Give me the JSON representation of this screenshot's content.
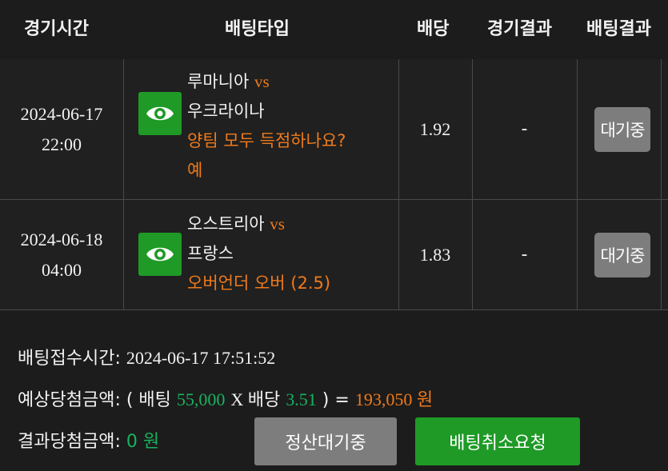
{
  "header": {
    "time": "경기시간",
    "bet_type": "배팅타입",
    "odds": "배당",
    "game_result": "경기결과",
    "bet_result": "배팅결과"
  },
  "bets": [
    {
      "date": "2024-06-17",
      "time": "22:00",
      "home": "루마니아",
      "vs": "vs",
      "away": "우크라이나",
      "market": "양팀 모두 득점하나요?",
      "pick": "예",
      "odds": "1.92",
      "result": "-",
      "status": "대기중",
      "icon": "eye-icon"
    },
    {
      "date": "2024-06-18",
      "time": "04:00",
      "home": "오스트리아",
      "vs": "vs",
      "away": "프랑스",
      "market": "오버언더 오버 (2.5)",
      "odds": "1.83",
      "result": "-",
      "status": "대기중",
      "icon": "eye-icon"
    }
  ],
  "summary": {
    "received_label": "배팅접수시간:",
    "received_time": "2024-06-17 17:51:52",
    "expected_label": "예상당첨금액:",
    "open_paren": "( 배팅",
    "bet_amount": "55,000",
    "times": "X 배당",
    "total_odds": "3.51",
    "equals": ") =",
    "expected_amount": "193,050 원",
    "result_label": "결과당첨금액:",
    "result_amount": "0 원",
    "settle_button": "정산대기중",
    "cancel_button": "배팅취소요청"
  },
  "colors": {
    "background": "#1c1c1c",
    "accent_orange": "#f07a1a",
    "accent_green": "#18b35e",
    "button_green": "#1f9a27",
    "button_gray": "#7d7d7d"
  }
}
